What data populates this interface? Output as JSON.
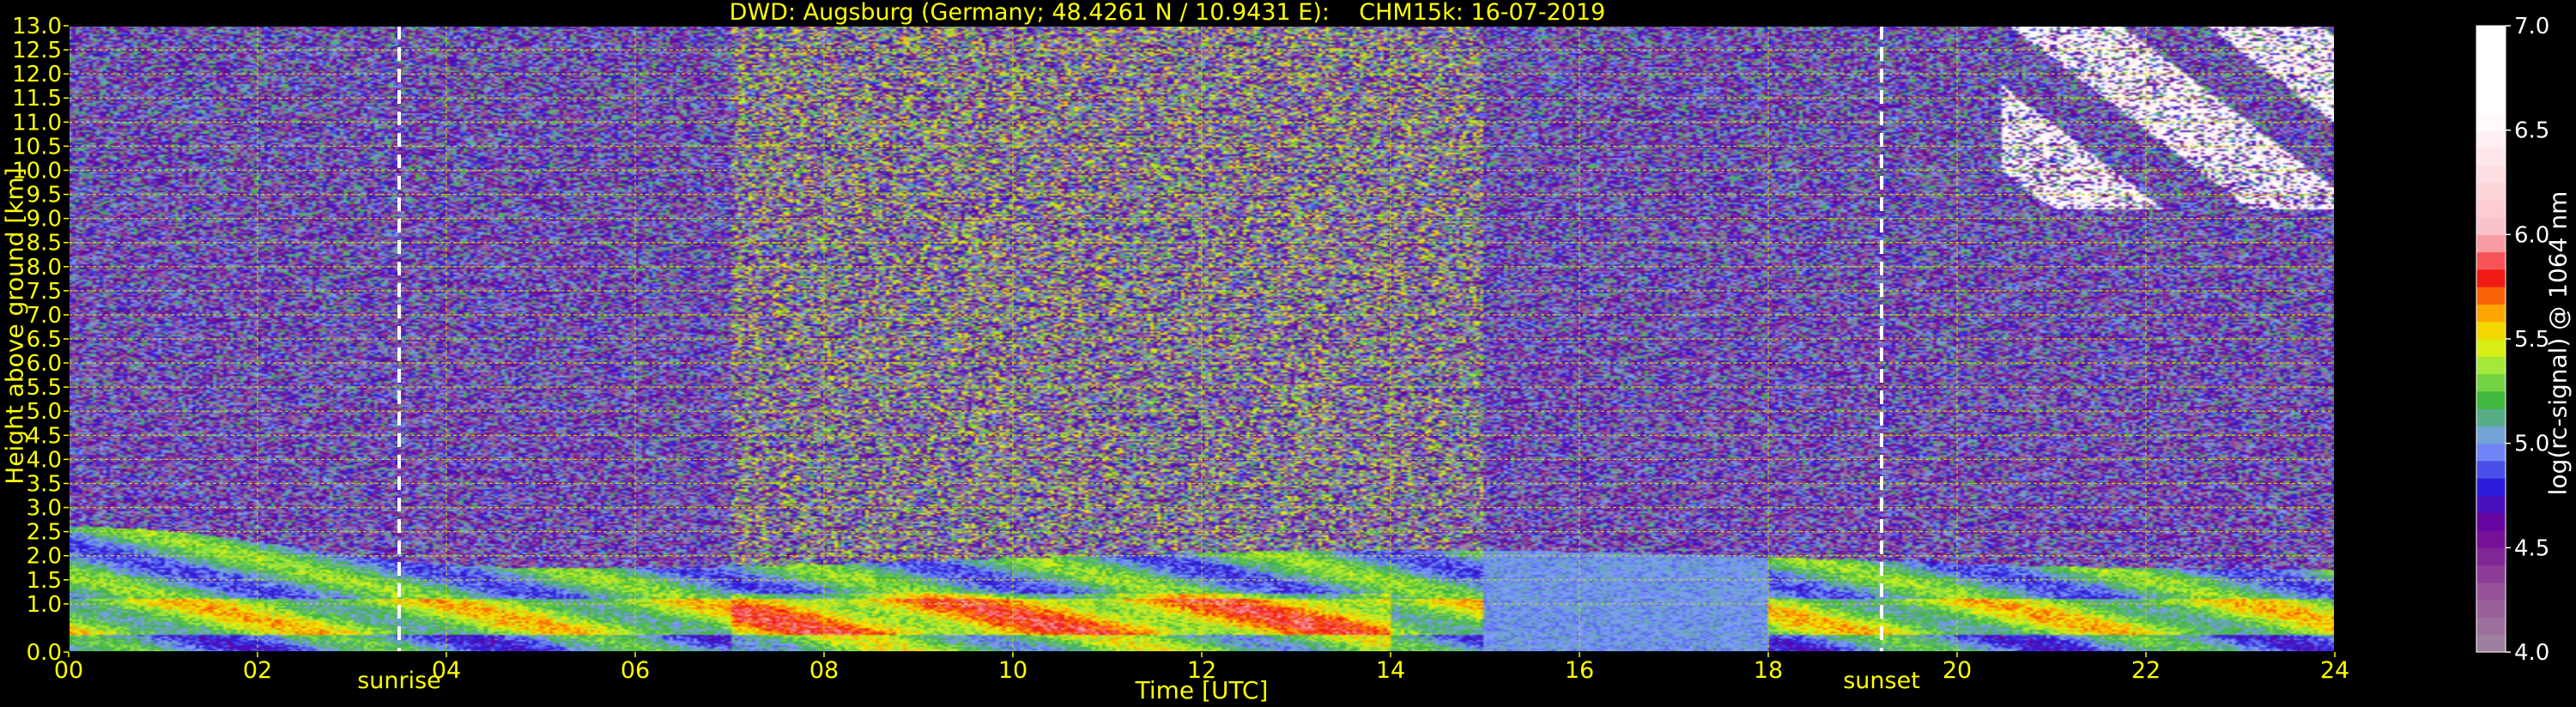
{
  "title": "DWD: Augsburg (Germany; 48.4261 N / 10.9431 E):    CHM15k: 16-07-2019",
  "chart_data": {
    "type": "heatmap",
    "xlabel": "Time [UTC]",
    "ylabel": "Height above ground [km]",
    "colorbar_label": "log(rc-signal) @ 1064 nm",
    "xlim": [
      0,
      24
    ],
    "ylim": [
      0,
      13
    ],
    "x_ticks": [
      "00",
      "02",
      "04",
      "06",
      "08",
      "10",
      "12",
      "14",
      "16",
      "18",
      "20",
      "22",
      "24"
    ],
    "y_ticks": [
      "0.0",
      "1.0",
      "1.5",
      "2.0",
      "2.5",
      "3.0",
      "3.5",
      "4.0",
      "4.5",
      "5.0",
      "5.5",
      "6.0",
      "6.5",
      "7.0",
      "7.5",
      "8.0",
      "8.5",
      "9.0",
      "9.5",
      "10.0",
      "10.5",
      "11.0",
      "11.5",
      "12.0",
      "12.5",
      "13.0"
    ],
    "y_tick_values": [
      0,
      1,
      1.5,
      2,
      2.5,
      3,
      3.5,
      4,
      4.5,
      5,
      5.5,
      6,
      6.5,
      7,
      7.5,
      8,
      8.5,
      9,
      9.5,
      10,
      10.5,
      11,
      11.5,
      12,
      12.5,
      13
    ],
    "colorbar_ticks": [
      "4.0",
      "4.5",
      "5.0",
      "5.5",
      "6.0",
      "6.5",
      "7.0"
    ],
    "colorbar_range": [
      4.0,
      7.0
    ],
    "grid": true,
    "events": [
      {
        "label": "sunrise",
        "time": 3.5
      },
      {
        "label": "sunset",
        "time": 19.2
      }
    ],
    "colors": {
      "text": "#ffff00",
      "grid": "#d8d800",
      "event_line": "#ffffff",
      "background": "#000000"
    }
  }
}
